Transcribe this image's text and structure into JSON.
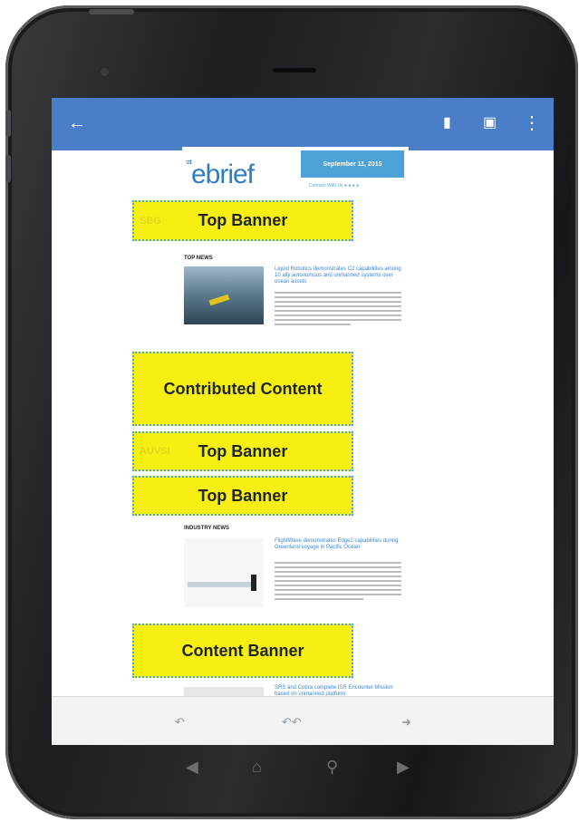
{
  "appbar": {
    "back_icon": "back-arrow-icon",
    "actions": [
      "delete-icon",
      "archive-icon",
      "more-vert-icon"
    ],
    "color": "#4a7ec9"
  },
  "email": {
    "logo": "ebrief",
    "logo_prefix": "sst",
    "date": "September 11, 2015",
    "social_label": "Connect With Us"
  },
  "banners": [
    {
      "label": "Top Banner",
      "ghost": "SBG"
    },
    {
      "label": "Contributed Content",
      "ghost": ""
    },
    {
      "label": "Top Banner",
      "ghost": "AUVSI"
    },
    {
      "label": "Top Banner",
      "ghost": ""
    },
    {
      "label": "Content Banner",
      "ghost": ""
    }
  ],
  "sections": {
    "top_news": "TOP NEWS",
    "industry_news": "INDUSTRY NEWS"
  },
  "articles": [
    {
      "headline": "Liquid Robotics demonstrates C2 capabilities among 10 ally autonomous and unmanned systems over ocean assets"
    },
    {
      "headline": "FlightWave demonstrates Edge2 capabilities during Greenland voyage in Pacific Ocean"
    },
    {
      "headline": "SRS and Cobra complete ISR Encounter Mission based on unmanned platform"
    }
  ],
  "bottombar": {
    "icons": [
      "reply-icon",
      "reply-all-icon",
      "forward-icon"
    ]
  },
  "navbar": {
    "icons": [
      "nav-back-icon",
      "nav-home-icon",
      "nav-search-icon",
      "nav-forward-icon"
    ]
  },
  "colors": {
    "banner_fill": "#f8ef12",
    "banner_border": "#4aa3e6",
    "accent_blue": "#4da3d8"
  }
}
